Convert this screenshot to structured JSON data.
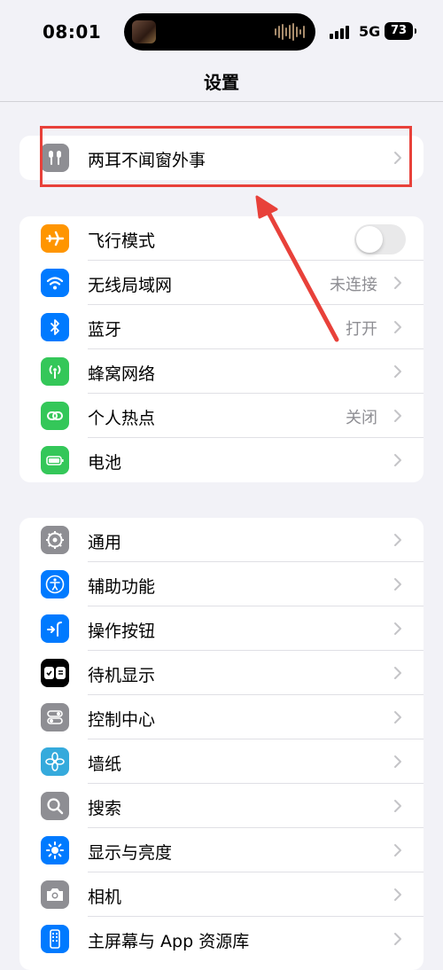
{
  "status_bar": {
    "time": "08:01",
    "network": "5G",
    "battery": "73"
  },
  "nav": {
    "title": "设置"
  },
  "groups": [
    {
      "items": [
        {
          "label": "两耳不闻窗外事",
          "icon": "airpods-icon",
          "color": "#8e8e93"
        }
      ]
    },
    {
      "items": [
        {
          "label": "飞行模式",
          "icon": "airplane-icon",
          "color": "#ff9500",
          "toggle_on": false
        },
        {
          "label": "无线局域网",
          "icon": "wifi-icon",
          "color": "#007aff",
          "value": "未连接"
        },
        {
          "label": "蓝牙",
          "icon": "bluetooth-icon",
          "color": "#007aff",
          "value": "打开"
        },
        {
          "label": "蜂窝网络",
          "icon": "cellular-icon",
          "color": "#34c759"
        },
        {
          "label": "个人热点",
          "icon": "hotspot-icon",
          "color": "#34c759",
          "value": "关闭"
        },
        {
          "label": "电池",
          "icon": "battery-icon",
          "color": "#34c759"
        }
      ]
    },
    {
      "items": [
        {
          "label": "通用",
          "icon": "gear-icon",
          "color": "#8e8e93"
        },
        {
          "label": "辅助功能",
          "icon": "accessibility-icon",
          "color": "#007aff"
        },
        {
          "label": "操作按钮",
          "icon": "action-button-icon",
          "color": "#007aff"
        },
        {
          "label": "待机显示",
          "icon": "standby-icon",
          "color": "#000000"
        },
        {
          "label": "控制中心",
          "icon": "control-center-icon",
          "color": "#8e8e93"
        },
        {
          "label": "墙纸",
          "icon": "wallpaper-icon",
          "color": "#35aadc"
        },
        {
          "label": "搜索",
          "icon": "search-icon",
          "color": "#8e8e93"
        },
        {
          "label": "显示与亮度",
          "icon": "brightness-icon",
          "color": "#007aff"
        },
        {
          "label": "相机",
          "icon": "camera-icon",
          "color": "#8e8e93"
        },
        {
          "label": "主屏幕与 App 资源库",
          "icon": "home-screen-icon",
          "color": "#007aff"
        }
      ]
    }
  ],
  "annotation": {
    "highlight_color": "#e8413a"
  }
}
